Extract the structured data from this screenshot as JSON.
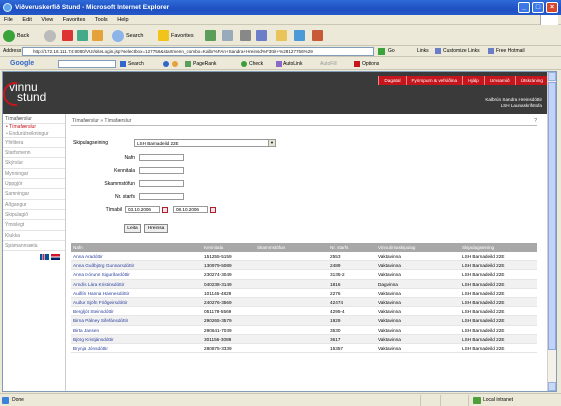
{
  "window": {
    "title": "Viðveruskerfið Stund - Microsoft Internet Explorer",
    "min": "_",
    "max": "□",
    "close": "×"
  },
  "menu": [
    "File",
    "Edit",
    "View",
    "Favorites",
    "Tools",
    "Help"
  ],
  "toolbar": {
    "back": "Back",
    "search": "Search",
    "favorites": "Favorites"
  },
  "address": {
    "label": "Address",
    "url": "http://172.16.111.74:8080/VUI/siteLogin.jsp?selectbox=127756&startmenn_combo=Kalbr%FAn+Sandra+Hreinsd%F3ttir+%28127756%29",
    "go": "Go",
    "links": "Links",
    "link1": "Customize Links",
    "link2": "Free Hotmail"
  },
  "google": {
    "logo": "Google",
    "search": "Search",
    "pagerank": "PageRank",
    "check": "Check",
    "autolink": "AutoLink",
    "autofill": "AutoFill",
    "options": "Options"
  },
  "app": {
    "logo_top": "vinnu",
    "logo_bottom": "stund",
    "nav": [
      "Dagatal",
      "Fyrirspurn & vefsíðina",
      "Hjálp",
      "Umsamið",
      "Útskráning"
    ],
    "user_name": "Kalbrún Sandra Hreinsdóttir",
    "user_unit": "LSH Launaskrifstofa",
    "sidebar": [
      "Tímafærslur",
      "• Tímafærslur",
      "• Endurútreikningur",
      "Yfirlitera",
      "Starfsmenn",
      "Skýrslur",
      "Mynningar",
      "Uppgjör",
      "Samningar",
      "Aðgangur",
      "Skipulagið",
      "Ýmislegt",
      "Klukka",
      "Spámannsæta"
    ],
    "breadcrumb": "Tímafærslur » Tímafærslur",
    "help_icon": "?",
    "form": {
      "unit_label": "Skipulagseining",
      "unit_value": "LSH Barnadeild 22E",
      "name_label": "Nafn",
      "ssn_label": "Kennitala",
      "alias_label": "Skammstöfun",
      "no_label": "Nr. starfs",
      "period_label": "Tímabil",
      "date_from": "03.10.2006",
      "date_to": "08.10.2006",
      "search_btn": "Leita",
      "clear_btn": "Hreinsa"
    },
    "table": {
      "headers": [
        "Nafn",
        "Kennitala",
        "Skammstöfun",
        "Nr. starfs",
        "Vinnutímaskipulag",
        "Skipulagseining"
      ],
      "rows": [
        [
          "Anna Aradóttir",
          "151255-5159",
          "",
          "2553",
          "Vaktavinna",
          "LSH Barnadeild 22E"
        ],
        [
          "Anna Guðbjörg Gunnarsdóttir",
          "130979-5089",
          "",
          "2489",
          "Vaktavinna",
          "LSH Barnadeild 22E"
        ],
        [
          "Anna Þórunn Sigurðardóttir",
          "230274-3049",
          "",
          "3135-2",
          "Vaktavinna",
          "LSH Barnadeild 22E"
        ],
        [
          "Arndís Lára Kristinsdóttir",
          "040238-3149",
          "",
          "1816",
          "Dagvinna",
          "LSH Barnadeild 22E"
        ],
        [
          "Auðlín Hanna Hannesdóttir",
          "101146-4829",
          "",
          "2276",
          "Vaktavinna",
          "LSH Barnadeild 22E"
        ],
        [
          "Auður Sjöfn Friðgeirsdóttir",
          "240276-3569",
          "",
          "42474",
          "Vaktavinna",
          "LSH Barnadeild 22E"
        ],
        [
          "Bergljót Steinsdóttir",
          "051178-5569",
          "",
          "4295-4",
          "Vaktavinna",
          "LSH Barnadeild 22E"
        ],
        [
          "Birna Pálney Sifefánsdóttir",
          "290265-3579",
          "",
          "1929",
          "Vaktavinna",
          "LSH Barnadeild 22E"
        ],
        [
          "Birta Jansen",
          "290641-7039",
          "",
          "3530",
          "Vaktavinna",
          "LSH Barnadeild 22E"
        ],
        [
          "Björg Kristjánsdóttir",
          "301156-3089",
          "",
          "3617",
          "Vaktavinna",
          "LSH Barnadeild 22E"
        ],
        [
          "Brynja Jónsdóttir",
          "280875-3339",
          "",
          "15357",
          "Vaktavinna",
          "LSH Barnadeild 22E"
        ]
      ]
    }
  },
  "status": {
    "left": "Done",
    "zone": "Local intranet"
  },
  "colors": {
    "titlebar": "#2458c9",
    "accent_red": "#c4161c",
    "header_dark": "#3a3a3a",
    "link_blue": "#2b3f9e"
  }
}
